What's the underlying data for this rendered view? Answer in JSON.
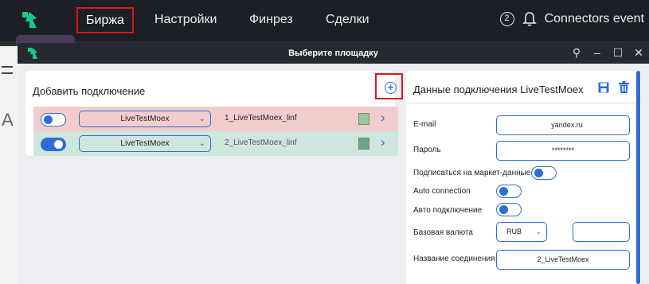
{
  "nav": {
    "items": [
      "Биржа",
      "Настройки",
      "Финрез",
      "Сделки"
    ],
    "notification_count": "2",
    "user_label": "Connectors event"
  },
  "background": {
    "left_glyph": "A"
  },
  "dialog": {
    "title": "Выберите площадку",
    "controls": [
      "pin",
      "minimize",
      "maximize",
      "close"
    ]
  },
  "connections": {
    "title": "Добавить подключение",
    "add_label": "+",
    "rows": [
      {
        "enabled": false,
        "exchange": "LiveTestMoex",
        "name": "1_LiveTestMoex_linf",
        "status_color": "#9fc59f",
        "row_color": "#f3cdcd"
      },
      {
        "enabled": true,
        "exchange": "LiveTestMoex",
        "name": "2_LiveTestMoex_linf",
        "status_color": "#6da68a",
        "row_color": "#cfe6dc"
      }
    ]
  },
  "details": {
    "title": "Данные подключения LiveTestMoex",
    "email_label": "E-mail",
    "email_value_prefix": "",
    "email_value_suffix": "yandex.ru",
    "password_label": "Пароль",
    "password_value": "********",
    "subscribe_label": "Подписаться на маркет-данные",
    "subscribe_enabled": false,
    "auto_label": "Auto connection",
    "auto_enabled": false,
    "auto_ru_label": "Авто подключение",
    "auto_ru_enabled": false,
    "currency_label": "Базовая валюта",
    "currency_value": "RUB",
    "currency_extra": "",
    "conn_name_label": "Название соединения",
    "conn_name_value": "2_LiveTestMoex"
  },
  "colors": {
    "accent": "#2d6dd6",
    "highlight": "#d8161b",
    "brand": "#1fd18a"
  }
}
